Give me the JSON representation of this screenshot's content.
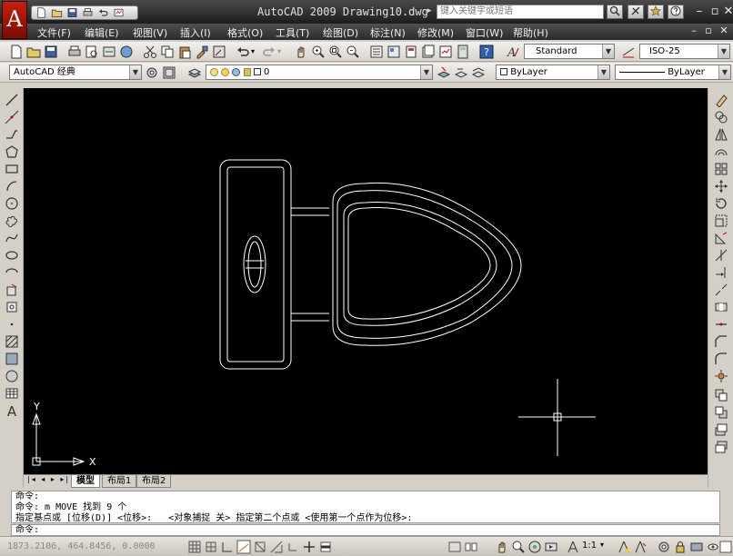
{
  "title": {
    "app_title": "AutoCAD 2009 Drawing10.dwg",
    "search_placeholder": "键入关键字或短语",
    "logo": "A"
  },
  "menu": [
    {
      "label": "文件(F)"
    },
    {
      "label": "编辑(E)"
    },
    {
      "label": "视图(V)"
    },
    {
      "label": "插入(I)"
    },
    {
      "label": "格式(O)"
    },
    {
      "label": "工具(T)"
    },
    {
      "label": "绘图(D)"
    },
    {
      "label": "标注(N)"
    },
    {
      "label": "修改(M)"
    },
    {
      "label": "窗口(W)"
    },
    {
      "label": "帮助(H)"
    }
  ],
  "styles": {
    "text_style": "Standard",
    "dim_style": "ISO-25"
  },
  "workspace": {
    "name": "AutoCAD 经典"
  },
  "layer": {
    "current": "0"
  },
  "properties": {
    "color": "ByLayer",
    "linetype": "ByLayer"
  },
  "tabs": [
    {
      "label": "模型",
      "active": true
    },
    {
      "label": "布局1",
      "active": false
    },
    {
      "label": "布局2",
      "active": false
    }
  ],
  "ucs": {
    "y_label": "Y",
    "x_label": "X"
  },
  "command": {
    "lines": [
      "命令:",
      "命令: m MOVE 找到 9 个",
      "指定基点或 [位移(D)] <位移>:   <对象捕捉 关> 指定第二个点或 <使用第一个点作为位移>:"
    ],
    "prompt": "命令:"
  },
  "status": {
    "coords": "1873.2106, 464.8456, 0.0000",
    "scale": "1:1"
  },
  "colors": {
    "canvas": "#000000",
    "drawing": "#ffffff",
    "title_bar": "#2a2a2a",
    "logo": "#b01c0c"
  }
}
